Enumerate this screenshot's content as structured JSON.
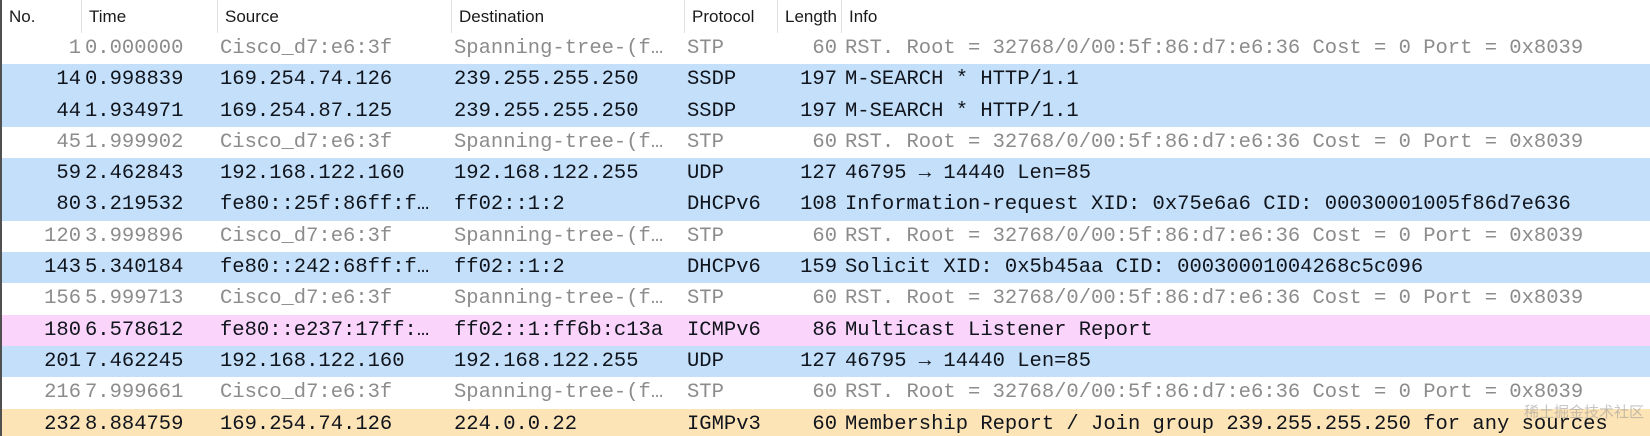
{
  "columns": {
    "no": "No.",
    "time": "Time",
    "source": "Source",
    "destination": "Destination",
    "protocol": "Protocol",
    "length": "Length",
    "info": "Info"
  },
  "colors": {
    "stp_bg": "#ffffff",
    "stp_fg": "#8c8c8c",
    "udp_bg": "#c4dff9",
    "udp_fg": "#10141c",
    "icmpv6_bg": "#fad4fb",
    "icmpv6_fg": "#10141c",
    "igmp_bg": "#fde4b6",
    "igmp_fg": "#10141c"
  },
  "packets": [
    {
      "no": "1",
      "time": "0.000000",
      "source": "Cisco_d7:e6:3f",
      "destination": "Spanning-tree-(f…",
      "protocol": "STP",
      "length": "60",
      "info": "RST. Root = 32768/0/00:5f:86:d7:e6:36  Cost = 0  Port = 0x8039",
      "kind": "stp"
    },
    {
      "no": "14",
      "time": "0.998839",
      "source": "169.254.74.126",
      "destination": "239.255.255.250",
      "protocol": "SSDP",
      "length": "197",
      "info": "M-SEARCH * HTTP/1.1",
      "kind": "udp"
    },
    {
      "no": "44",
      "time": "1.934971",
      "source": "169.254.87.125",
      "destination": "239.255.255.250",
      "protocol": "SSDP",
      "length": "197",
      "info": "M-SEARCH * HTTP/1.1",
      "kind": "udp"
    },
    {
      "no": "45",
      "time": "1.999902",
      "source": "Cisco_d7:e6:3f",
      "destination": "Spanning-tree-(f…",
      "protocol": "STP",
      "length": "60",
      "info": "RST. Root = 32768/0/00:5f:86:d7:e6:36  Cost = 0  Port = 0x8039",
      "kind": "stp"
    },
    {
      "no": "59",
      "time": "2.462843",
      "source": "192.168.122.160",
      "destination": "192.168.122.255",
      "protocol": "UDP",
      "length": "127",
      "info": "46795 → 14440 Len=85",
      "kind": "udp"
    },
    {
      "no": "80",
      "time": "3.219532",
      "source": "fe80::25f:86ff:f…",
      "destination": "ff02::1:2",
      "protocol": "DHCPv6",
      "length": "108",
      "info": "Information-request XID: 0x75e6a6 CID: 00030001005f86d7e636",
      "kind": "udp"
    },
    {
      "no": "120",
      "time": "3.999896",
      "source": "Cisco_d7:e6:3f",
      "destination": "Spanning-tree-(f…",
      "protocol": "STP",
      "length": "60",
      "info": "RST. Root = 32768/0/00:5f:86:d7:e6:36  Cost = 0  Port = 0x8039",
      "kind": "stp"
    },
    {
      "no": "143",
      "time": "5.340184",
      "source": "fe80::242:68ff:f…",
      "destination": "ff02::1:2",
      "protocol": "DHCPv6",
      "length": "159",
      "info": "Solicit XID: 0x5b45aa CID: 00030001004268c5c096",
      "kind": "udp"
    },
    {
      "no": "156",
      "time": "5.999713",
      "source": "Cisco_d7:e6:3f",
      "destination": "Spanning-tree-(f…",
      "protocol": "STP",
      "length": "60",
      "info": "RST. Root = 32768/0/00:5f:86:d7:e6:36  Cost = 0  Port = 0x8039",
      "kind": "stp"
    },
    {
      "no": "180",
      "time": "6.578612",
      "source": "fe80::e237:17ff:…",
      "destination": "ff02::1:ff6b:c13a",
      "protocol": "ICMPv6",
      "length": "86",
      "info": "Multicast Listener Report",
      "kind": "icmpv6"
    },
    {
      "no": "201",
      "time": "7.462245",
      "source": "192.168.122.160",
      "destination": "192.168.122.255",
      "protocol": "UDP",
      "length": "127",
      "info": "46795 → 14440 Len=85",
      "kind": "udp"
    },
    {
      "no": "216",
      "time": "7.999661",
      "source": "Cisco_d7:e6:3f",
      "destination": "Spanning-tree-(f…",
      "protocol": "STP",
      "length": "60",
      "info": "RST. Root = 32768/0/00:5f:86:d7:e6:36  Cost = 0  Port = 0x8039",
      "kind": "stp"
    },
    {
      "no": "232",
      "time": "8.884759",
      "source": "169.254.74.126",
      "destination": "224.0.0.22",
      "protocol": "IGMPv3",
      "length": "60",
      "info": "Membership Report / Join group 239.255.255.250 for any sources",
      "kind": "igmp"
    }
  ],
  "watermark": "稀土掘金技术社区"
}
